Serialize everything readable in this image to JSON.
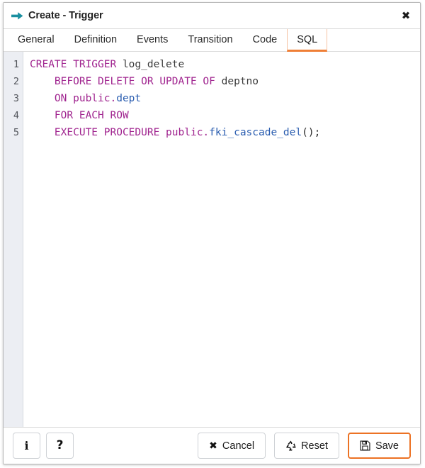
{
  "window": {
    "title": "Create - Trigger",
    "title_icon": "arrow-right-icon",
    "close_icon": "close-icon",
    "accent_color": "#ec7224",
    "title_icon_color": "#1a8fa0"
  },
  "tabs": [
    {
      "label": "General",
      "active": false
    },
    {
      "label": "Definition",
      "active": false
    },
    {
      "label": "Events",
      "active": false
    },
    {
      "label": "Transition",
      "active": false
    },
    {
      "label": "Code",
      "active": false
    },
    {
      "label": "SQL",
      "active": true
    }
  ],
  "editor": {
    "line_numbers": [
      "1",
      "2",
      "3",
      "4",
      "5"
    ],
    "colors": {
      "keyword": "#a0248f",
      "identifier": "#3b3b3b",
      "object": "#2a5db0",
      "punctuation": "#2b2b2b",
      "gutter_bg": "#eceef3"
    },
    "lines": [
      {
        "tokens": [
          {
            "t": "CREATE TRIGGER ",
            "k": "kw"
          },
          {
            "t": "log_delete",
            "k": "ident"
          }
        ]
      },
      {
        "tokens": [
          {
            "t": "    BEFORE DELETE OR UPDATE OF ",
            "k": "kw"
          },
          {
            "t": "deptno",
            "k": "ident"
          }
        ]
      },
      {
        "tokens": [
          {
            "t": "    ON public.",
            "k": "kw"
          },
          {
            "t": "dept",
            "k": "obj"
          }
        ]
      },
      {
        "tokens": [
          {
            "t": "    FOR EACH ROW",
            "k": "kw"
          }
        ]
      },
      {
        "tokens": [
          {
            "t": "    EXECUTE PROCEDURE public.",
            "k": "kw"
          },
          {
            "t": "fki_cascade_del",
            "k": "obj"
          },
          {
            "t": "();",
            "k": "punc"
          }
        ]
      }
    ],
    "plain_text": "CREATE TRIGGER log_delete\n    BEFORE DELETE OR UPDATE OF deptno\n    ON public.dept\n    FOR EACH ROW\n    EXECUTE PROCEDURE public.fki_cascade_del();"
  },
  "footer": {
    "info_label": "",
    "info_icon": "info-icon",
    "info_glyph": "i",
    "help_label": "",
    "help_icon": "help-icon",
    "help_glyph": "?",
    "cancel_label": "Cancel",
    "cancel_icon": "close-x-icon",
    "cancel_glyph": "✖",
    "reset_label": "Reset",
    "reset_icon": "recycle-icon",
    "save_label": "Save",
    "save_icon": "floppy-disk-icon"
  }
}
